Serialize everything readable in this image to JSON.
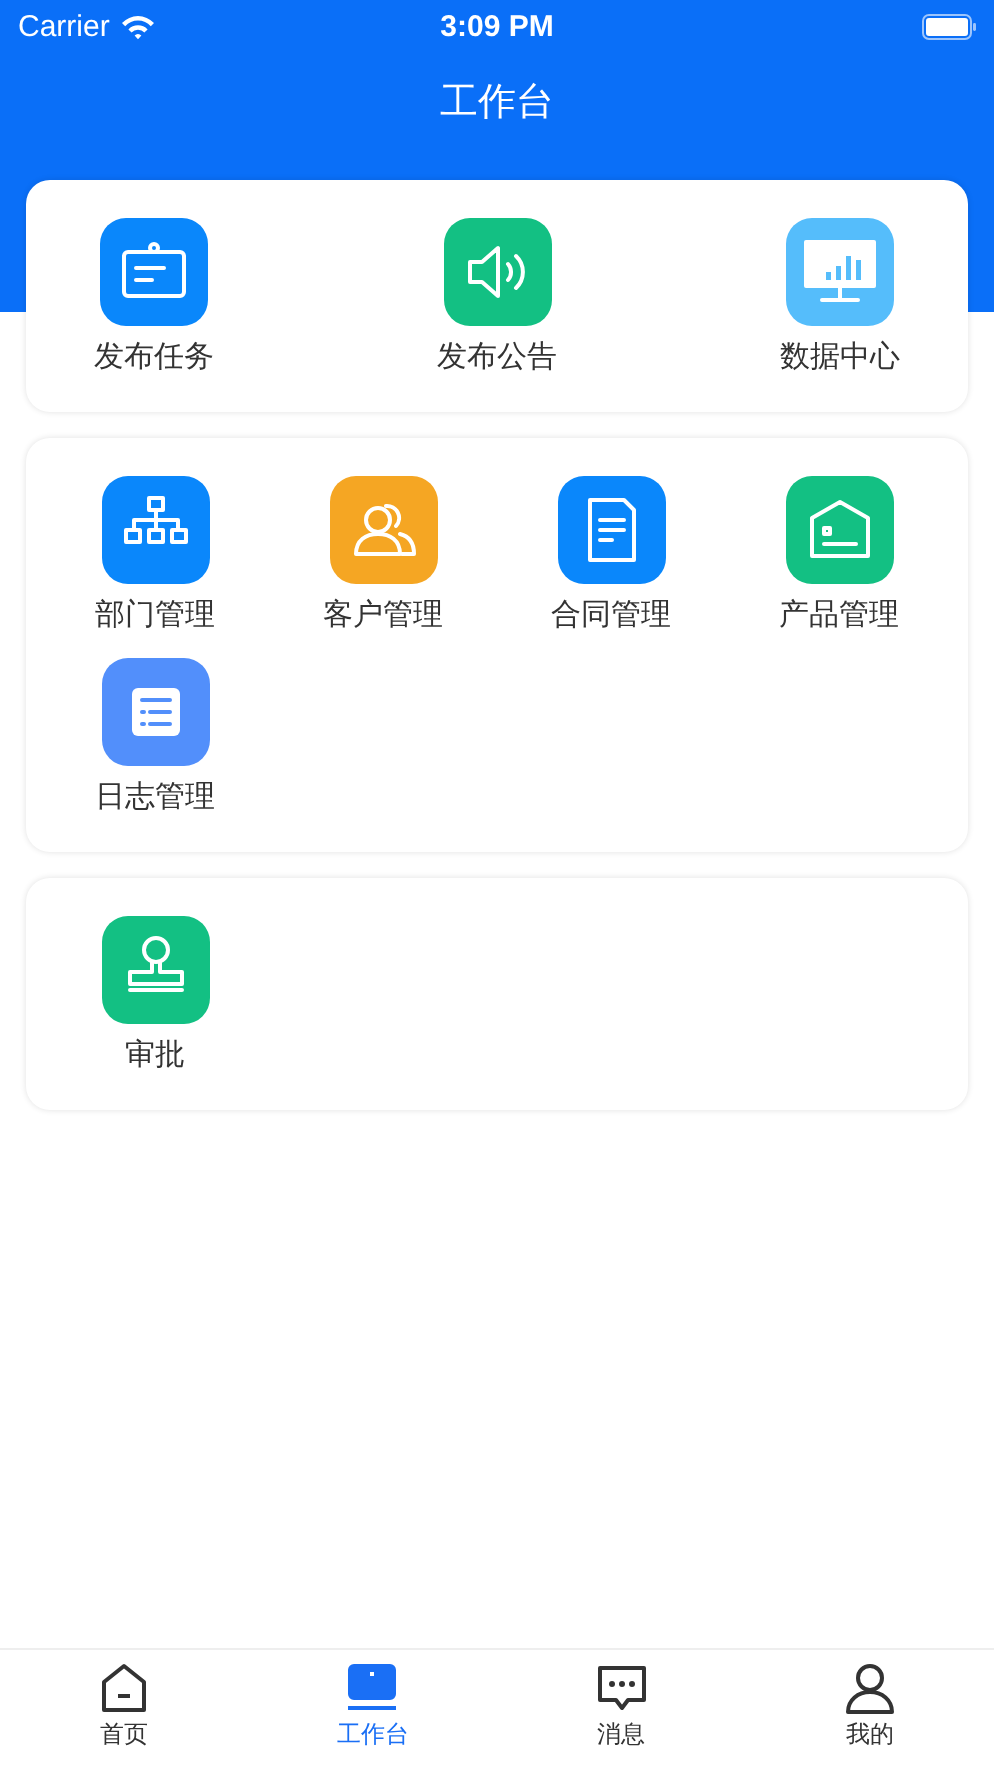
{
  "status_bar": {
    "carrier": "Carrier",
    "time": "3:09 PM"
  },
  "nav_bar": {
    "title": "工作台"
  },
  "sections": [
    {
      "kind": "spread",
      "items": [
        {
          "label": "发布任务",
          "kind": "clipboard",
          "color": "#0a87fb"
        },
        {
          "label": "发布公告",
          "kind": "speaker",
          "color": "#13c083"
        },
        {
          "label": "数据中心",
          "kind": "monitor",
          "color": "#55bdfb"
        }
      ]
    },
    {
      "kind": "grid",
      "items": [
        {
          "label": "部门管理",
          "kind": "org",
          "color": "#0a87fb"
        },
        {
          "label": "客户管理",
          "kind": "people",
          "color": "#f5a623"
        },
        {
          "label": "合同管理",
          "kind": "document",
          "color": "#0a87fb"
        },
        {
          "label": "产品管理",
          "kind": "house",
          "color": "#13c083"
        },
        {
          "label": "日志管理",
          "kind": "list",
          "color": "#528ffb"
        }
      ]
    },
    {
      "kind": "grid",
      "items": [
        {
          "label": "审批",
          "kind": "stamp",
          "color": "#13c083"
        }
      ]
    }
  ],
  "tab_bar": [
    {
      "label": "首页",
      "kind": "home",
      "selected": false
    },
    {
      "label": "工作台",
      "kind": "laptop",
      "selected": true
    },
    {
      "label": "消息",
      "kind": "chat",
      "selected": false
    },
    {
      "label": "我的",
      "kind": "person",
      "selected": false
    }
  ]
}
